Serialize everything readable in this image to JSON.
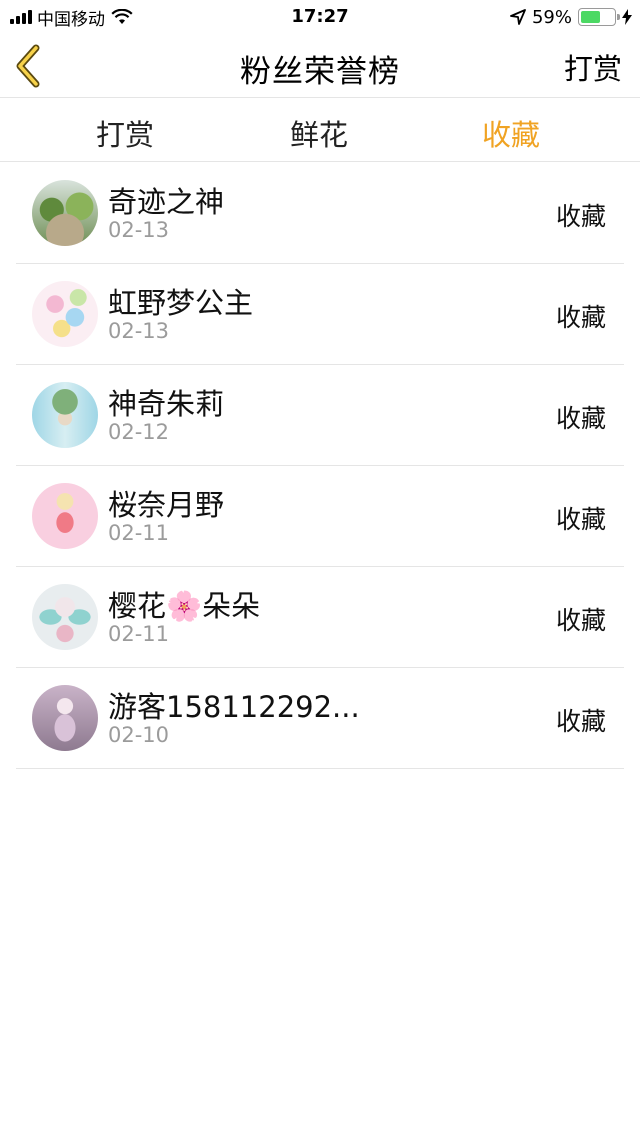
{
  "status_bar": {
    "carrier": "中国移动",
    "time": "17:27",
    "battery": "59%",
    "battery_level": 0.59,
    "battery_color": "#4cd964"
  },
  "nav": {
    "back_icon": "chevron-left-icon",
    "title": "粉丝荣誉榜",
    "right_label": "打赏"
  },
  "tabs": [
    {
      "label": "打赏",
      "active": false
    },
    {
      "label": "鲜花",
      "active": false
    },
    {
      "label": "收藏",
      "active": true
    }
  ],
  "accent_color": "#f0a323",
  "fans": [
    {
      "name": "奇迹之神",
      "date": "02-13",
      "action": "收藏"
    },
    {
      "name": "虹野梦公主",
      "date": "02-13",
      "action": "收藏"
    },
    {
      "name": "神奇朱莉",
      "date": "02-12",
      "action": "收藏"
    },
    {
      "name": "桜奈月野",
      "date": "02-11",
      "action": "收藏"
    },
    {
      "name": "樱花🌸朵朵",
      "date": "02-11",
      "action": "收藏"
    },
    {
      "name": "游客158112292...",
      "date": "02-10",
      "action": "收藏"
    }
  ]
}
